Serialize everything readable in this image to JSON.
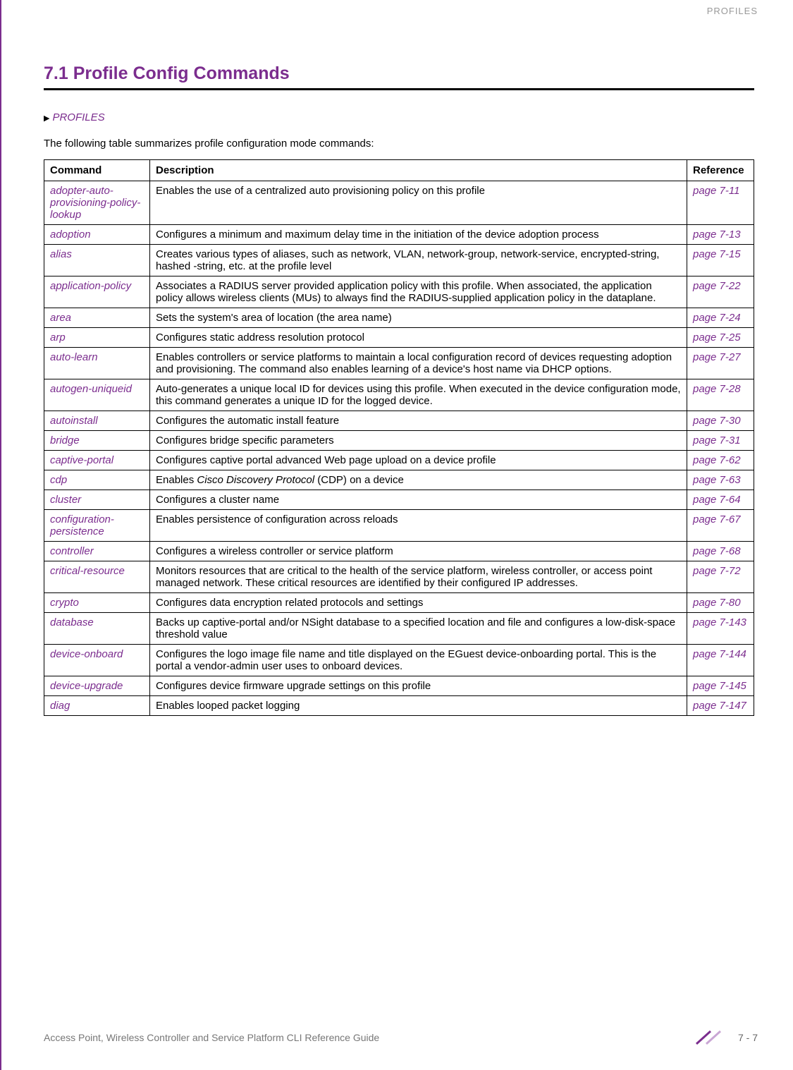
{
  "header_right": "PROFILES",
  "section_title": "7.1 Profile Config Commands",
  "breadcrumb": "PROFILES",
  "intro": "The following table summarizes profile configuration mode commands:",
  "table_headers": {
    "command": "Command",
    "description": "Description",
    "reference": "Reference"
  },
  "rows": [
    {
      "cmd": "adopter-auto-provisioning-policy-lookup",
      "desc": "Enables the use of a centralized auto provisioning policy on this profile",
      "ref": "page 7-11"
    },
    {
      "cmd": "adoption",
      "desc": "Configures a minimum and maximum delay time in the initiation of the device adoption process",
      "ref": "page 7-13"
    },
    {
      "cmd": "alias",
      "desc": "Creates various types of aliases, such as network, VLAN, network-group, network-service, encrypted-string, hashed -string, etc. at the profile level",
      "ref": "page 7-15"
    },
    {
      "cmd": "application-policy",
      "desc": "Associates a RADIUS server provided application policy with this profile. When associated, the application policy allows wireless clients (MUs) to always find the RADIUS-supplied application policy in the dataplane.",
      "ref": "page 7-22"
    },
    {
      "cmd": "area",
      "desc": "Sets the system's area of location (the area name)",
      "ref": "page 7-24"
    },
    {
      "cmd": "arp",
      "desc": "Configures static address resolution protocol",
      "ref": "page 7-25"
    },
    {
      "cmd": "auto-learn",
      "desc": "Enables controllers or service platforms to maintain a local configuration record of devices requesting adoption and provisioning. The command also enables learning of a device's host name via DHCP options.",
      "ref": "page 7-27"
    },
    {
      "cmd": "autogen-uniqueid",
      "desc": "Auto-generates a unique local ID for devices using this profile. When executed in the device configuration mode, this command generates a unique ID for the logged device.",
      "ref": "page 7-28"
    },
    {
      "cmd": "autoinstall",
      "desc": "Configures the automatic install feature",
      "ref": "page 7-30"
    },
    {
      "cmd": "bridge",
      "desc": "Configures bridge specific parameters",
      "ref": "page 7-31"
    },
    {
      "cmd": "captive-portal",
      "desc": "Configures captive portal advanced Web page upload on a device profile",
      "ref": "page 7-62"
    },
    {
      "cmd": "cdp",
      "desc_html": "Enables <span class=\"desc-italic\">Cisco Discovery Protocol</span> (CDP) on a device",
      "ref": "page 7-63"
    },
    {
      "cmd": "cluster",
      "desc": "Configures a cluster name",
      "ref": "page 7-64"
    },
    {
      "cmd": "configuration-persistence",
      "desc": "Enables persistence of configuration across reloads",
      "ref": "page 7-67"
    },
    {
      "cmd": "controller",
      "desc": "Configures a wireless controller or service platform",
      "ref": "page 7-68"
    },
    {
      "cmd": "critical-resource",
      "desc": "Monitors resources that are critical to the health of the service platform, wireless controller, or access point managed network. These critical resources are identified by their configured IP addresses.",
      "ref": "page 7-72"
    },
    {
      "cmd": "crypto",
      "desc": "Configures data encryption related protocols and settings",
      "ref": "page 7-80"
    },
    {
      "cmd": "database",
      "desc": "Backs up captive-portal and/or NSight database to a specified location and file and configures a low-disk-space threshold value",
      "ref": "page 7-143"
    },
    {
      "cmd": "device-onboard",
      "desc": "Configures the logo image file name and title displayed on the EGuest device-onboarding portal. This is the portal a vendor-admin user uses to onboard devices.",
      "ref": "page 7-144"
    },
    {
      "cmd": "device-upgrade",
      "desc": "Configures device firmware upgrade settings on this profile",
      "ref": "page 7-145"
    },
    {
      "cmd": "diag",
      "desc": "Enables looped packet logging",
      "ref": "page 7-147"
    }
  ],
  "footer_left": "Access Point, Wireless Controller and Service Platform CLI Reference Guide",
  "footer_page": "7 - 7"
}
